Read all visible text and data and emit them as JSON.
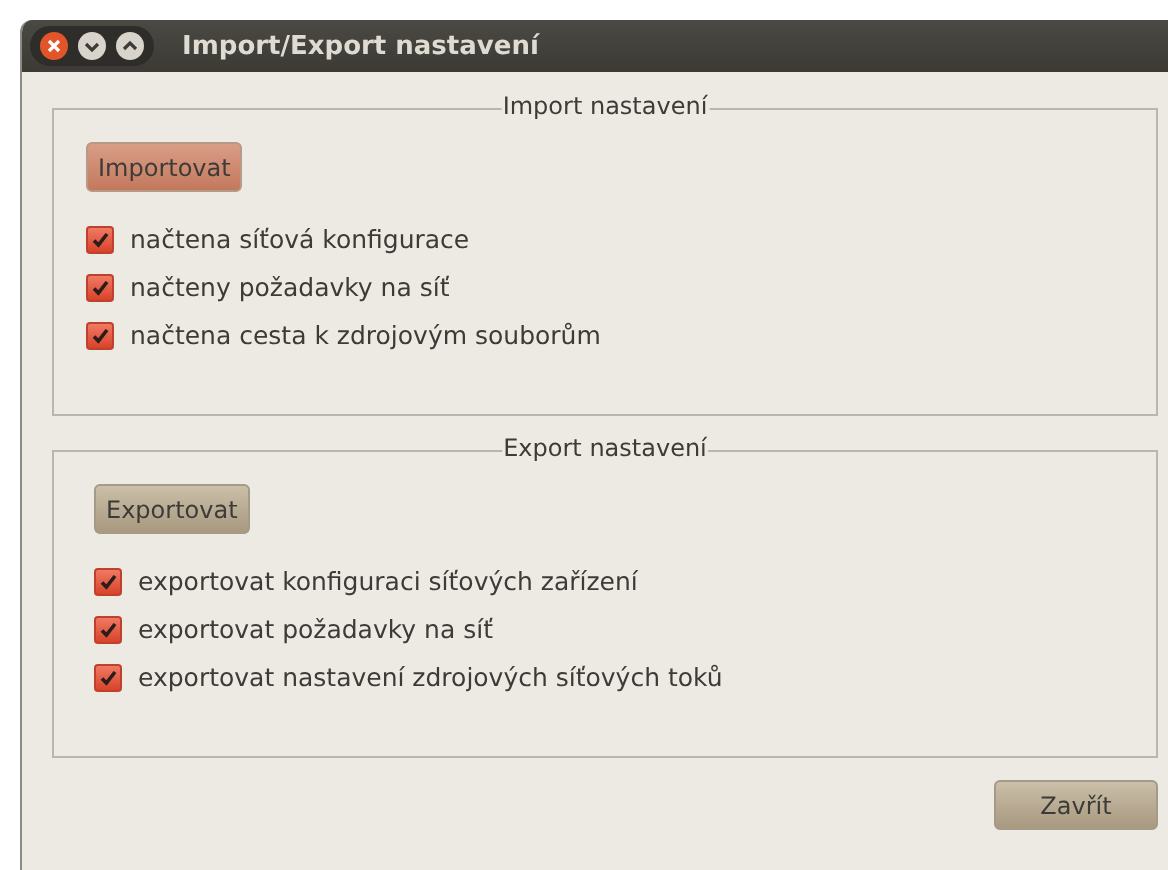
{
  "window": {
    "title": "Import/Export nastavení"
  },
  "groups": [
    {
      "title": "Import nastavení",
      "button": {
        "label": "Importovat",
        "highlighted": true
      },
      "options": [
        {
          "label": "načtena síťová konfigurace",
          "checked": true
        },
        {
          "label": "načteny požadavky na síť",
          "checked": true
        },
        {
          "label": "načtena cesta k zdrojovým souborům",
          "checked": true
        }
      ]
    },
    {
      "title": "Export nastavení",
      "button": {
        "label": "Exportovat",
        "highlighted": false
      },
      "options": [
        {
          "label": "exportovat konfiguraci síťových zařízení",
          "checked": true
        },
        {
          "label": "exportovat požadavky na síť",
          "checked": true
        },
        {
          "label": "exportovat nastavení zdrojových síťových toků",
          "checked": true
        }
      ]
    }
  ],
  "close_button": {
    "label": "Zavřít"
  }
}
